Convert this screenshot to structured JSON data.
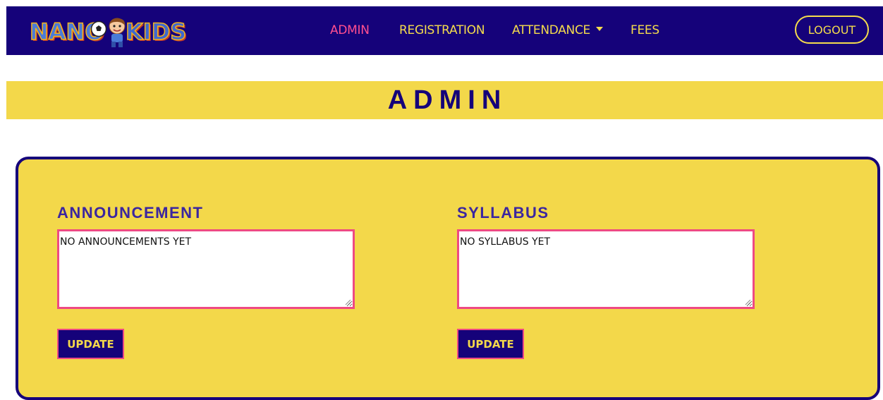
{
  "brand": {
    "part1": "NANO",
    "part2": "KIDS",
    "colors": {
      "nano": "#4a7bd8",
      "kids": "#3f68cf",
      "outline": "#f5b31a"
    }
  },
  "nav": {
    "items": [
      {
        "label": "ADMIN",
        "active": true
      },
      {
        "label": "REGISTRATION",
        "active": false
      },
      {
        "label": "ATTENDANCE",
        "active": false,
        "dropdown": true
      },
      {
        "label": "FEES",
        "active": false
      }
    ],
    "logout_label": "LOGOUT"
  },
  "page": {
    "title": "ADMIN"
  },
  "announcement": {
    "heading": "ANNOUNCEMENT",
    "value": "NO ANNOUNCEMENTS YET",
    "button_label": "UPDATE"
  },
  "syllabus": {
    "heading": "SYLLABUS",
    "value": "NO SYLLABUS YET",
    "button_label": "UPDATE"
  },
  "colors": {
    "navy": "#15027a",
    "yellow": "#f3d84a",
    "pink": "#ee4a83",
    "heading_purple": "#3b26a0"
  },
  "icons": {
    "ball": "soccer-ball-icon",
    "mascot": "kid-mascot-icon",
    "caret": "caret-down-icon",
    "grip": "resize-grip-icon"
  }
}
